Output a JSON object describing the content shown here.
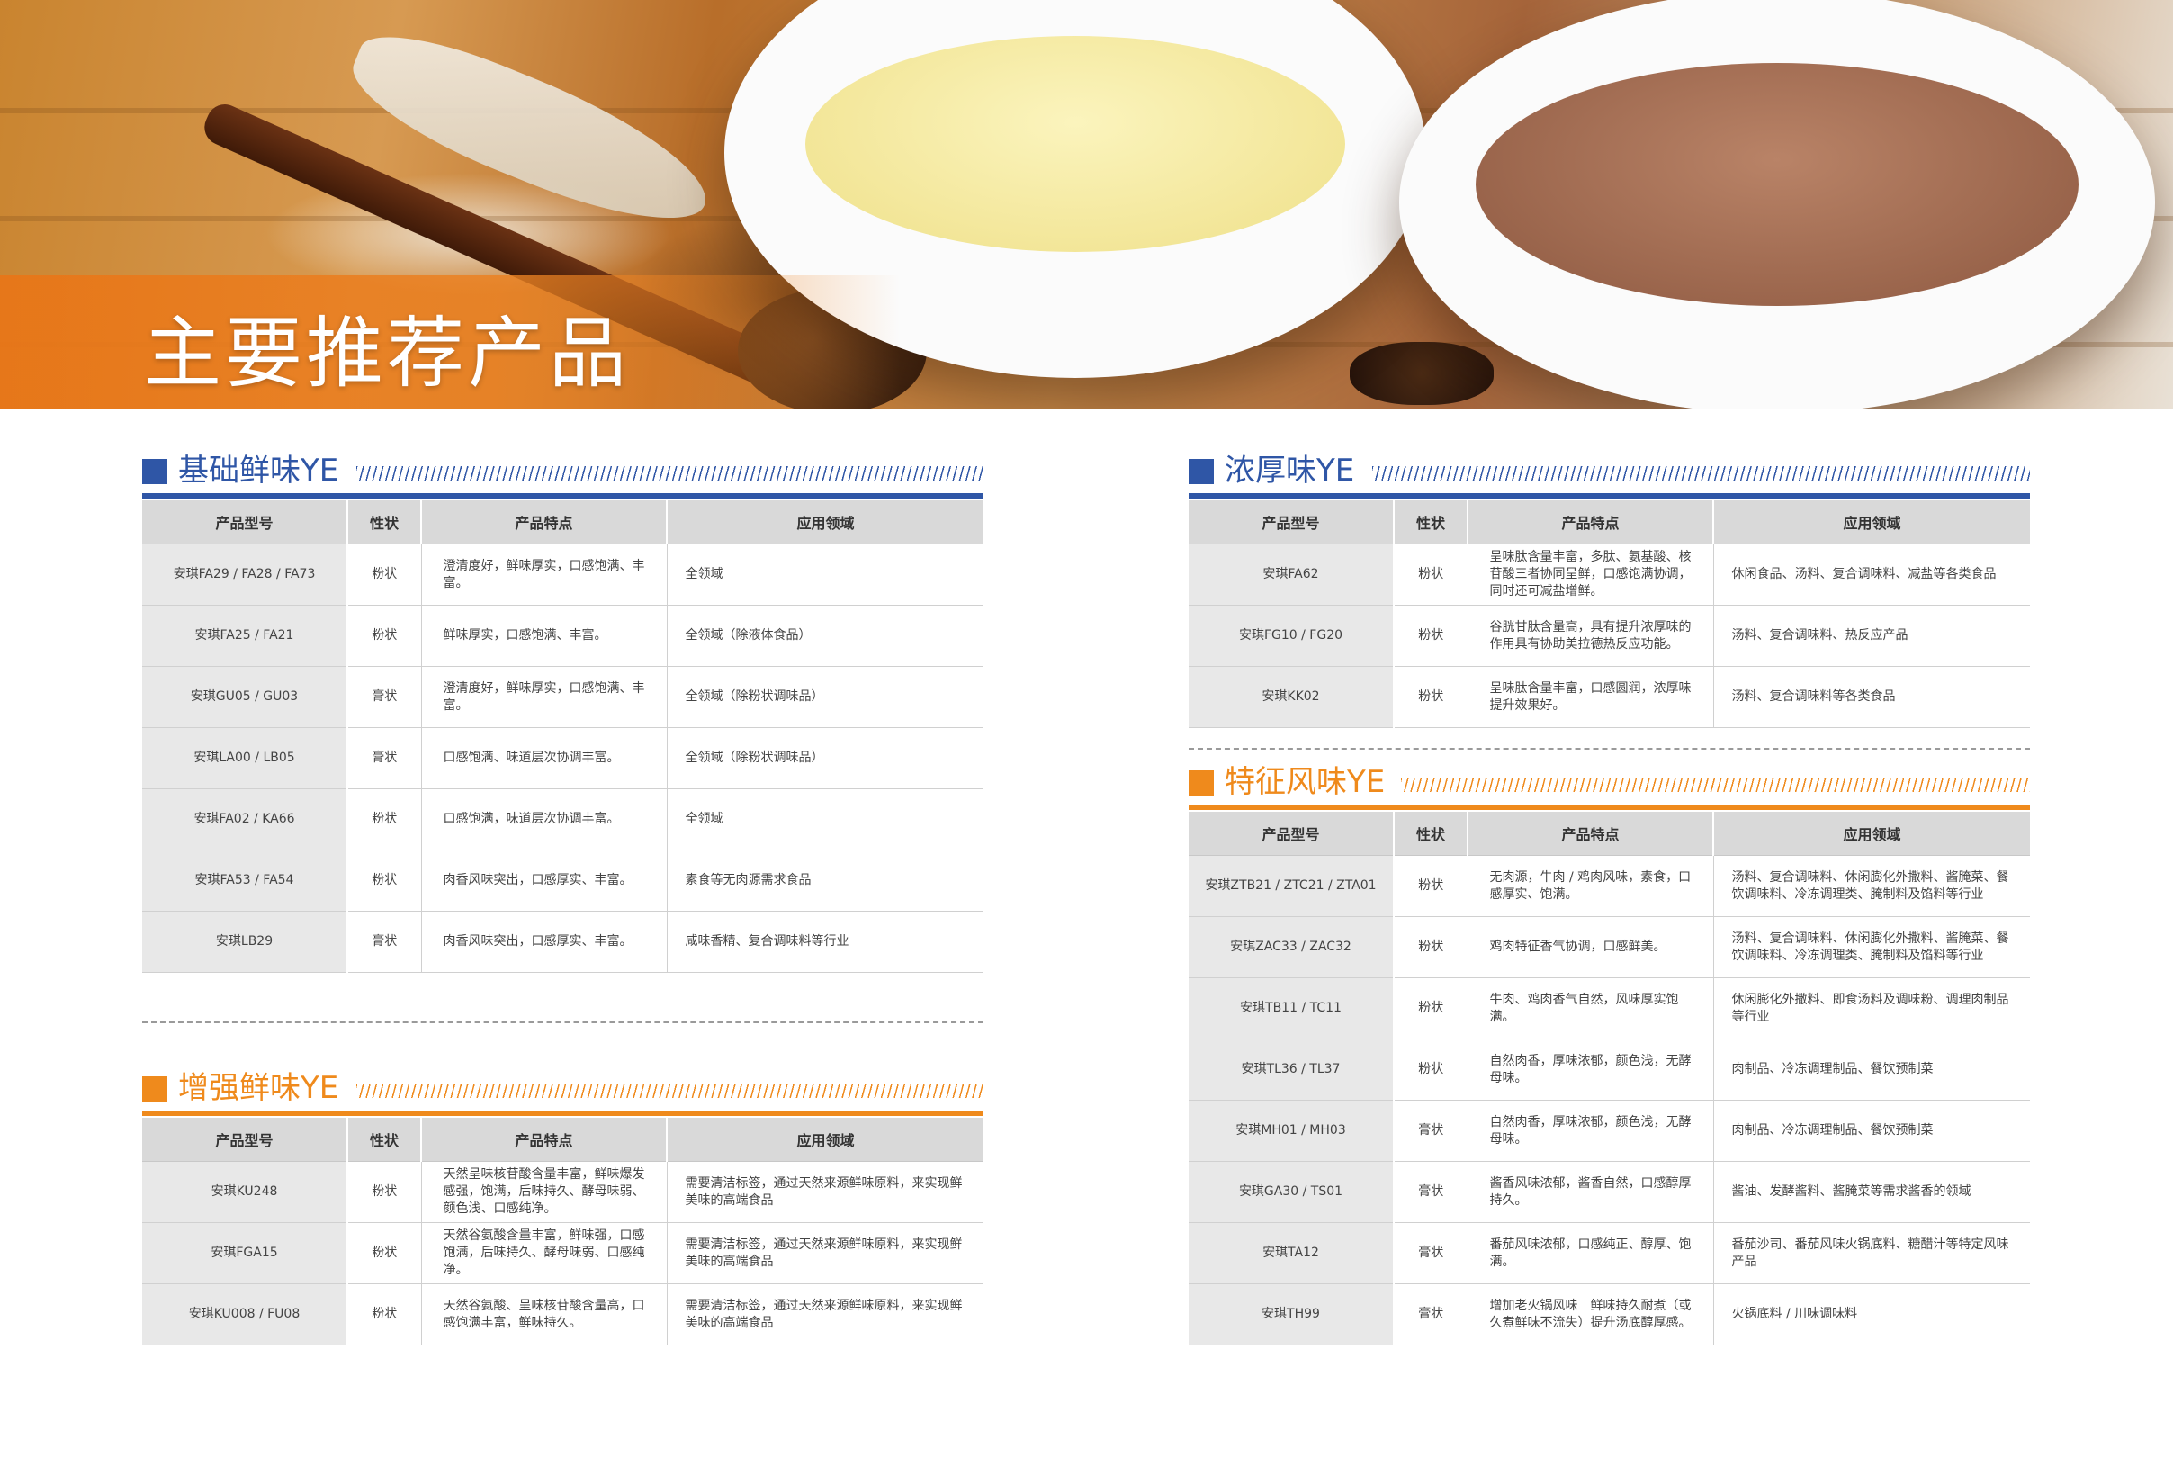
{
  "page": {
    "title": "主要推荐产品"
  },
  "headers": [
    "产品型号",
    "性状",
    "产品特点",
    "应用领域"
  ],
  "sections": {
    "basic": {
      "title": "基础鲜味YE",
      "rows": [
        {
          "model": "安琪FA29 / FA28 / FA73",
          "form": "粉状",
          "feature": "澄清度好，鲜味厚实，口感饱满、丰富。",
          "application": "全领域"
        },
        {
          "model": "安琪FA25 / FA21",
          "form": "粉状",
          "feature": "鲜味厚实，口感饱满、丰富。",
          "application": "全领域（除液体食品）"
        },
        {
          "model": "安琪GU05 / GU03",
          "form": "膏状",
          "feature": "澄清度好，鲜味厚实，口感饱满、丰富。",
          "application": "全领域（除粉状调味品）"
        },
        {
          "model": "安琪LA00 / LB05",
          "form": "膏状",
          "feature": "口感饱满、味道层次协调丰富。",
          "application": "全领域（除粉状调味品）"
        },
        {
          "model": "安琪FA02 / KA66",
          "form": "粉状",
          "feature": "口感饱满，味道层次协调丰富。",
          "application": "全领域"
        },
        {
          "model": "安琪FA53 / FA54",
          "form": "粉状",
          "feature": "肉香风味突出，口感厚实、丰富。",
          "application": "素食等无肉源需求食品"
        },
        {
          "model": "安琪LB29",
          "form": "膏状",
          "feature": "肉香风味突出，口感厚实、丰富。",
          "application": "咸味香精、复合调味料等行业"
        }
      ]
    },
    "enhanced": {
      "title": "增强鲜味YE",
      "rows": [
        {
          "model": "安琪KU248",
          "form": "粉状",
          "feature": "天然呈味核苷酸含量丰富，鲜味爆发感强，饱满，后味持久、酵母味弱、颜色浅、口感纯净。",
          "application": "需要清洁标签，通过天然来源鲜味原料，来实现鲜美味的高端食品"
        },
        {
          "model": "安琪FGA15",
          "form": "粉状",
          "feature": "天然谷氨酸含量丰富，鲜味强，口感饱满，后味持久、酵母味弱、口感纯净。",
          "application": "需要清洁标签，通过天然来源鲜味原料，来实现鲜美味的高端食品"
        },
        {
          "model": "安琪KU008 / FU08",
          "form": "粉状",
          "feature": "天然谷氨酸、呈味核苷酸含量高，口感饱满丰富，鲜味持久。",
          "application": "需要清洁标签，通过天然来源鲜味原料，来实现鲜美味的高端食品"
        }
      ]
    },
    "rich": {
      "title": "浓厚味YE",
      "rows": [
        {
          "model": "安琪FA62",
          "form": "粉状",
          "feature": "呈味肽含量丰富，多肽、氨基酸、核苷酸三者协同呈鲜，口感饱满协调，同时还可减盐增鲜。",
          "application": "休闲食品、汤料、复合调味料、减盐等各类食品"
        },
        {
          "model": "安琪FG10 / FG20",
          "form": "粉状",
          "feature": "谷胱甘肽含量高，具有提升浓厚味的作用具有协助美拉德热反应功能。",
          "application": "汤料、复合调味料、热反应产品"
        },
        {
          "model": "安琪KK02",
          "form": "粉状",
          "feature": "呈味肽含量丰富，口感圆润，浓厚味提升效果好。",
          "application": "汤料、复合调味料等各类食品"
        }
      ]
    },
    "flavor": {
      "title": "特征风味YE",
      "rows": [
        {
          "model": "安琪ZTB21 / ZTC21 / ZTA01",
          "form": "粉状",
          "feature": "无肉源，牛肉 / 鸡肉风味，素食，口感厚实、饱满。",
          "application": "汤料、复合调味料、休闲膨化外撒料、酱腌菜、餐饮调味料、冷冻调理类、腌制料及馅料等行业"
        },
        {
          "model": "安琪ZAC33 / ZAC32",
          "form": "粉状",
          "feature": "鸡肉特征香气协调，口感鲜美。",
          "application": "汤料、复合调味料、休闲膨化外撒料、酱腌菜、餐饮调味料、冷冻调理类、腌制料及馅料等行业"
        },
        {
          "model": "安琪TB11 / TC11",
          "form": "粉状",
          "feature": "牛肉、鸡肉香气自然，风味厚实饱满。",
          "application": "休闲膨化外撒料、即食汤料及调味粉、调理肉制品等行业"
        },
        {
          "model": "安琪TL36 / TL37",
          "form": "粉状",
          "feature": "自然肉香，厚味浓郁，颜色浅，无酵母味。",
          "application": "肉制品、冷冻调理制品、餐饮预制菜"
        },
        {
          "model": "安琪MH01 / MH03",
          "form": "膏状",
          "feature": "自然肉香，厚味浓郁，颜色浅，无酵母味。",
          "application": "肉制品、冷冻调理制品、餐饮预制菜"
        },
        {
          "model": "安琪GA30 / TS01",
          "form": "膏状",
          "feature": "酱香风味浓郁，酱香自然，口感醇厚持久。",
          "application": "酱油、发酵酱料、酱腌菜等需求酱香的领域"
        },
        {
          "model": "安琪TA12",
          "form": "膏状",
          "feature": "番茄风味浓郁，口感纯正、醇厚、饱满。",
          "application": "番茄沙司、番茄风味火锅底料、糖醋汁等特定风味产品"
        },
        {
          "model": "安琪TH99",
          "form": "膏状",
          "feature": "增加老火锅风味　鲜味持久耐煮（或久煮鲜味不流失）提升汤底醇厚感。",
          "application": "火锅底料 / 川味调味料"
        }
      ]
    }
  }
}
